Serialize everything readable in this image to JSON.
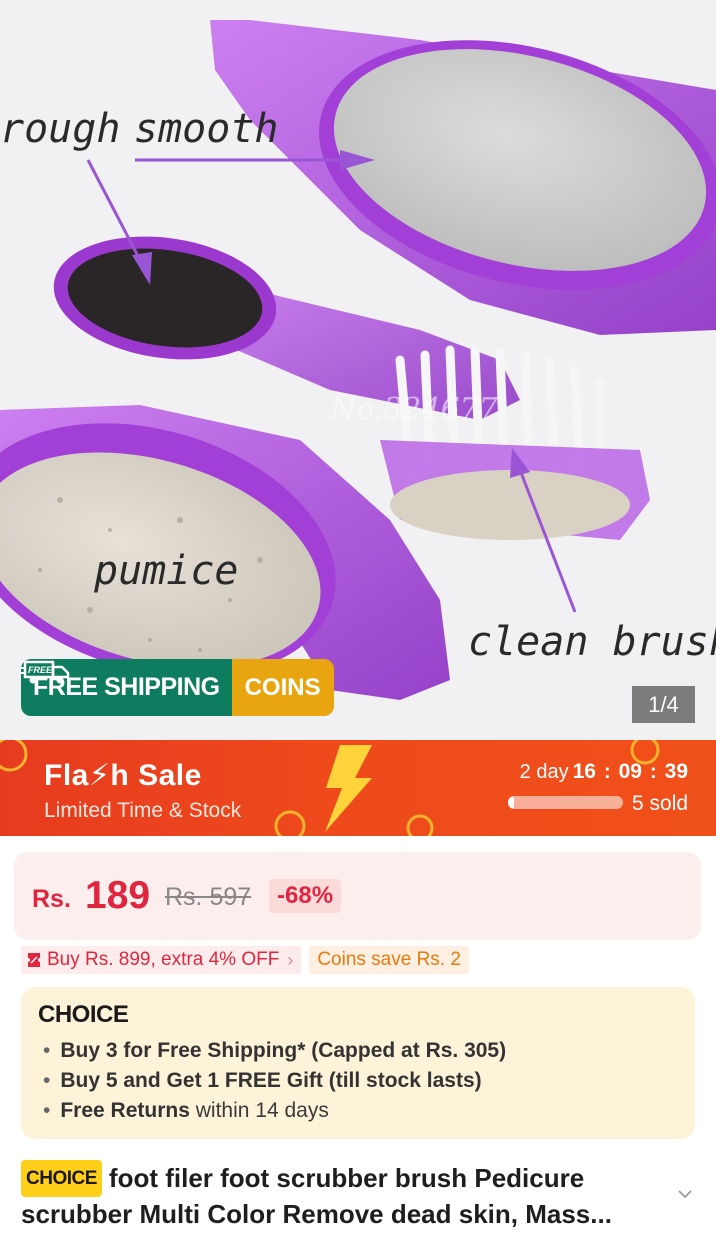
{
  "product_image": {
    "labels": {
      "rough": "rough",
      "smooth": "smooth",
      "pumice": "pumice",
      "clean_brush": "clean brush"
    },
    "watermark": "No.324677",
    "shipping_badge": {
      "icon_text": "FREE",
      "free_shipping": "FREE SHIPPING",
      "coins": "COINS"
    },
    "counter": "1/4"
  },
  "flash_sale": {
    "title": "Fla⚡h Sale",
    "subtitle": "Limited Time & Stock",
    "countdown": {
      "days_label": "2 day",
      "hours": "16",
      "minutes": "09",
      "seconds": "39"
    },
    "sold_progress": 0.05,
    "sold_text": "5 sold"
  },
  "price": {
    "currency": "Rs.",
    "current": "189",
    "original": "Rs. 597",
    "discount": "-68%"
  },
  "promotions": {
    "buy_offer": "Buy Rs. 899, extra 4% OFF",
    "coins_save": "Coins save Rs. 2"
  },
  "choice": {
    "logo": "CHOICE",
    "benefits": [
      {
        "strong": "Buy 3 for  Free Shipping* (Capped at Rs. 305)",
        "rest": ""
      },
      {
        "strong": "Buy 5 and Get 1 FREE Gift (till stock lasts)",
        "rest": ""
      },
      {
        "strong": "Free Returns",
        "rest": " within 14 days"
      }
    ]
  },
  "title": {
    "tag": "CHOICE",
    "line1": "foot filer foot scrubber brush Pedicure",
    "line2": "scrubber Multi Color Remove dead skin, Mass..."
  },
  "colors": {
    "flash_red": "#e63b1f",
    "price_red": "#e0263f",
    "shipping_green": "#0e7d5f",
    "coins_orange": "#e9a50f",
    "choice_bg": "#fdf3d9",
    "choice_tag_yellow": "#ffcf1a",
    "brush_purple": "#a23fd6"
  }
}
